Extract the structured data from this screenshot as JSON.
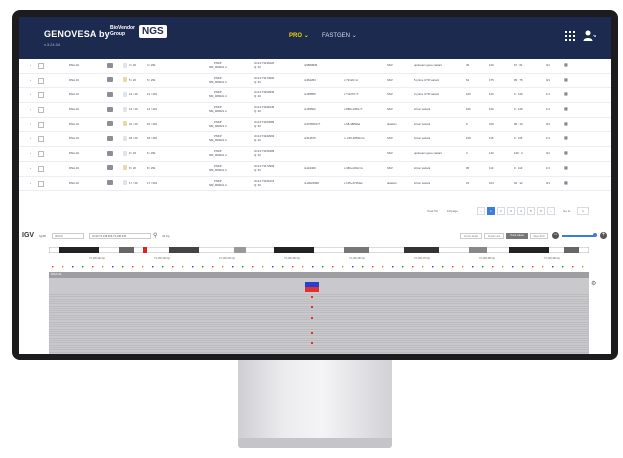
{
  "header": {
    "brand": "GENOVESA by",
    "version": "v.3.24.04",
    "vendor_line1": "BioVendor",
    "vendor_line2": "Group",
    "product": "NGS",
    "nav": [
      {
        "label": "PRO"
      },
      {
        "label": "FASTGEN"
      }
    ],
    "pro_color": "#f0d400",
    "icons": [
      "grid-icon",
      "user-icon"
    ]
  },
  "table": {
    "rows": [
      {
        "sample": "DNA-01",
        "rank": "4 / 20",
        "total": "4 / 291",
        "gene": "PNKP",
        "transcript": "NM_000021.4",
        "pos": "chr14:73136420",
        "quality": "Q: 40",
        "dbsnp": "rs5860839",
        "hgvs": "",
        "zyg": "SNV",
        "effect": "upstream gene variant",
        "dp": "46",
        "af": "126",
        "alleles": "67 : 61",
        "gt": "0/1"
      },
      {
        "sample": "DNA-01",
        "rank": "5 / 20",
        "total": "5 / 291",
        "gene": "PNKP",
        "transcript": "NM_000021.4",
        "pos": "chr14:73173900",
        "quality": "Q: 40",
        "dbsnp": "rs362284",
        "hgvs": "c.?212C>A",
        "zyg": "SNV",
        "effect": "5 prime UTR variant",
        "dp": "64",
        "af": "175",
        "alleles": "95 : 75",
        "gt": "0/1"
      },
      {
        "sample": "DNA-01",
        "rank": "14 / 20",
        "total": "14 / 291",
        "gene": "PNKP",
        "transcript": "NM_000021.4",
        "pos": "chr14:73220936",
        "quality": "Q: 40",
        "dbsnp": "rs165855",
        "hgvs": "c.*1147C>T",
        "zyg": "SNV",
        "effect": "3 prime UTR variant",
        "dp": "106",
        "af": "126",
        "alleles": "0 : 126",
        "gt": "1/1"
      },
      {
        "sample": "DNA-01",
        "rank": "14 / 20",
        "total": "14 / 291",
        "gene": "PNKP",
        "transcript": "NM_000021.4",
        "pos": "chr14:73198145",
        "quality": "Q: 40",
        "dbsnp": "rs165502",
        "hgvs": "c.868+135G>T",
        "zyg": "SNV",
        "effect": "intron variant",
        "dp": "106",
        "af": "126",
        "alleles": "0 : 126",
        "gt": "1/1"
      },
      {
        "sample": "DNA-01",
        "rank": "16 / 20",
        "total": "16 / 291",
        "gene": "PNKP",
        "transcript": "NM_000021.4",
        "pos": "chr14:73163989",
        "quality": "Q: 40",
        "dbsnp": "rs376835177",
        "hgvs": "c.68-4880del",
        "zyg": "deletion",
        "effect": "intron variant",
        "dp": "9",
        "af": "106",
        "alleles": "96 : 10",
        "gt": "0/1"
      },
      {
        "sample": "DNA-01",
        "rank": "18 / 20",
        "total": "18 / 291",
        "gene": "PNKP",
        "transcript": "NM_000021.4",
        "pos": "chr14:73162993",
        "quality": "Q: 40",
        "dbsnp": "rs314576",
        "hgvs": "c.-135-4853A>G",
        "zyg": "SNV",
        "effect": "intron variant",
        "dp": "108",
        "af": "115",
        "alleles": "0 : 115",
        "gt": "1/1"
      },
      {
        "sample": "DNA-01",
        "rank": "6 / 20",
        "total": "6 / 291",
        "gene": "PNKP",
        "transcript": "NM_000021.4",
        "pos": "chr14:73156489",
        "quality": "Q: 40",
        "dbsnp": "",
        "hgvs": "",
        "zyg": "SNV",
        "effect": "upstream gene variant",
        "dp": "4",
        "af": "140",
        "alleles": "136 : 4",
        "gt": "0/1"
      },
      {
        "sample": "DNA-01",
        "rank": "8 / 20",
        "total": "8 / 291",
        "gene": "PNKP",
        "transcript": "NM_000021.4",
        "pos": "chr14:73172909",
        "quality": "Q: 40",
        "dbsnp": "rs142409",
        "hgvs": "c.460+232A>G",
        "zyg": "SNV",
        "effect": "intron variant",
        "dp": "95",
        "af": "113",
        "alleles": "0 : 113",
        "gt": "1/1"
      },
      {
        "sample": "DNA-01",
        "rank": "17 / 20",
        "total": "17 / 291",
        "gene": "PNKP",
        "transcript": "NM_000021.4",
        "pos": "chr14:73161016",
        "quality": "Q: 40",
        "dbsnp": "rs10623998",
        "hgvs": "c.135+4725del",
        "zyg": "deletion",
        "effect": "intron variant",
        "dp": "15",
        "af": "104",
        "alleles": "92 : 12",
        "gt": "0/1"
      }
    ]
  },
  "pager": {
    "total": "Total 53",
    "page_size": "10/page",
    "pages": [
      "1",
      "2",
      "3",
      "4",
      "5",
      "6"
    ],
    "active_page": "1",
    "goto": "Go to",
    "goto_value": "1"
  },
  "igv": {
    "logo": "IGV",
    "genome": "hg38",
    "chrom": "chr14",
    "locus": "chr14:73,138,453-73,138,445",
    "zoom_label": "41 bp",
    "track_label": "DNA-01",
    "ticks": [
      "73,138,420 bp",
      "73,138,430 bp",
      "73,138,440 bp",
      "73,138,450 bp",
      "73,138,460 bp",
      "73,138,470 bp",
      "73,138,480 bp",
      "73,138,490 bp"
    ],
    "buttons": [
      "Cursor Guide",
      "Center Line",
      "Track Labels",
      "Save SVG"
    ],
    "colors": {
      "read": "#c9c9cc",
      "mismatch": "#e03030",
      "insert": "#2a3fd0"
    }
  }
}
